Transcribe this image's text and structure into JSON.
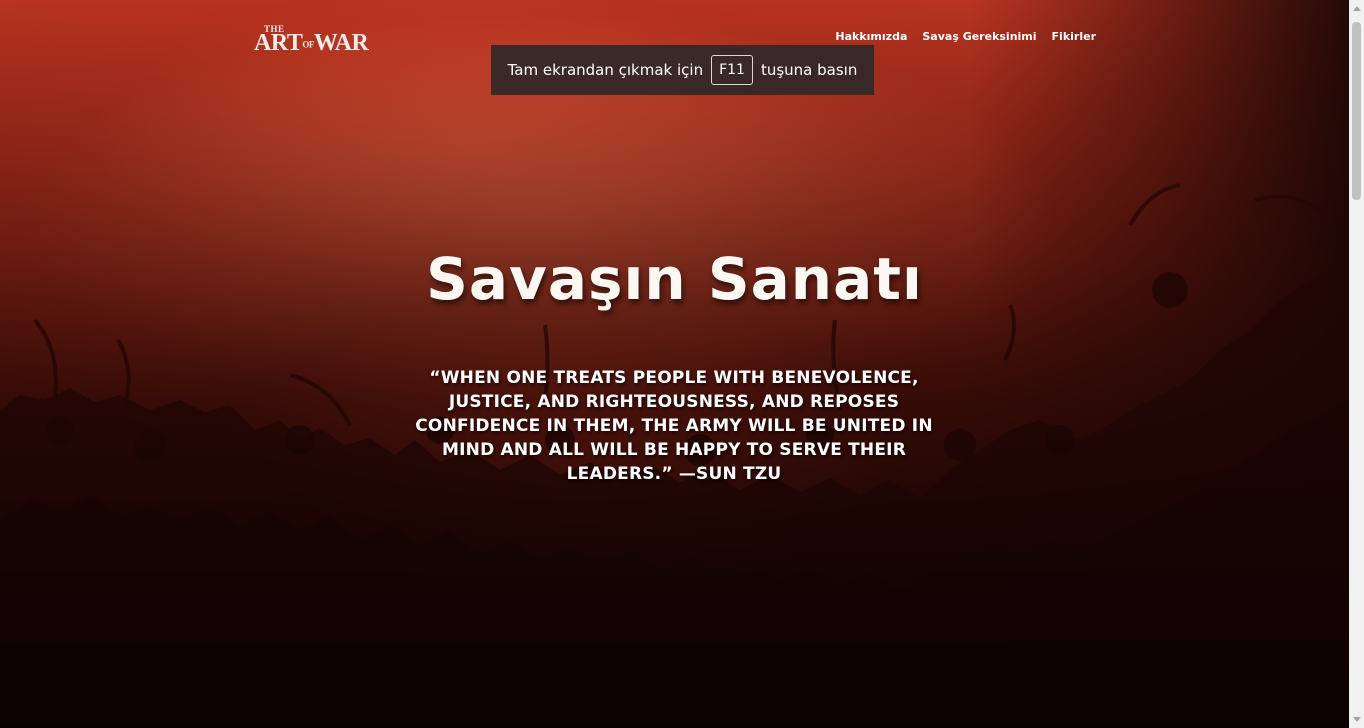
{
  "logo": {
    "the": "THE",
    "art": "ART",
    "of": "OF",
    "war": "WAR"
  },
  "nav": {
    "items": [
      "Hakkımızda",
      "Savaş Gereksinimi",
      "Fikirler"
    ]
  },
  "toast": {
    "before": "Tam ekrandan çıkmak için",
    "key": "F11",
    "after": "tuşuna basın"
  },
  "hero": {
    "title": "Savaşın Sanatı",
    "quote": "“WHEN ONE TREATS PEOPLE WITH BENEVOLENCE, JUSTICE, AND RIGHTEOUSNESS, AND REPOSES CONFIDENCE IN THEM, THE ARMY WILL BE UNITED IN MIND AND ALL WILL BE HAPPY TO SERVE THEIR LEADERS.” —SUN TZU"
  },
  "colors": {
    "accent": "#b8321f",
    "text": "#ffffff",
    "toast_bg": "#302828"
  }
}
